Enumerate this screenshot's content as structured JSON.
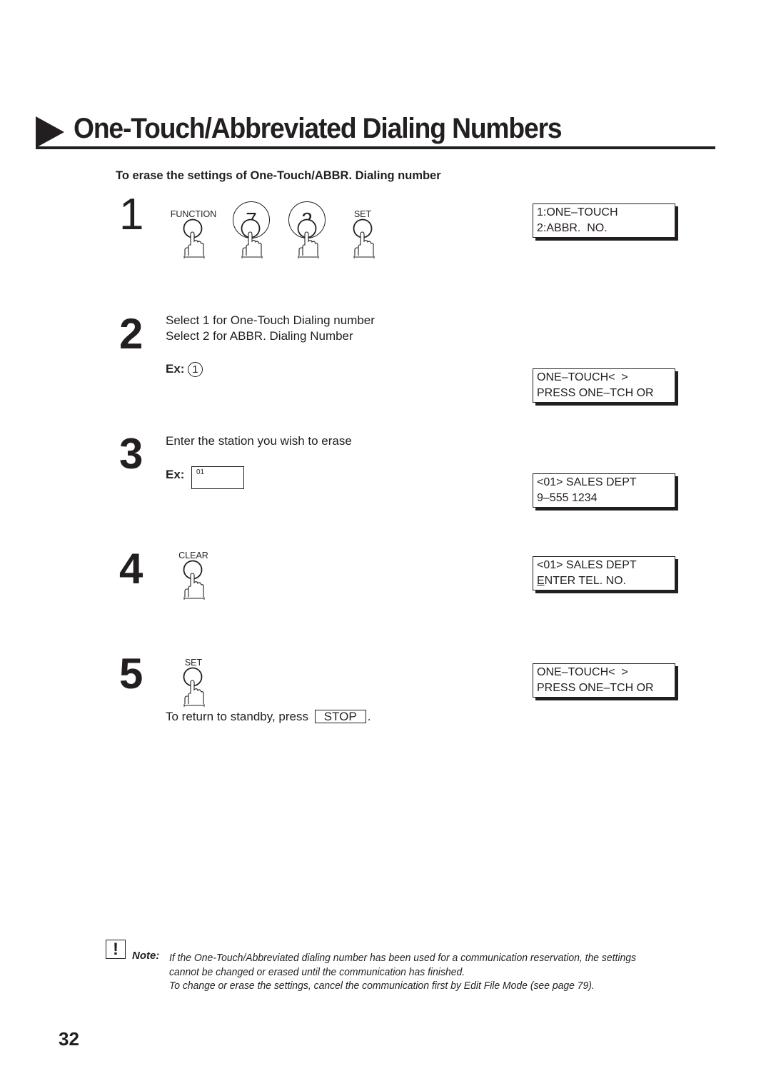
{
  "header": {
    "title": "One-Touch/Abbreviated Dialing Numbers",
    "subtitle": "To erase the settings of One-Touch/ABBR. Dialing number"
  },
  "steps": [
    {
      "number": "1",
      "keys": [
        {
          "label": "FUNCTION",
          "type": "small",
          "icon": "hand-press-icon"
        },
        {
          "label": "7",
          "type": "big",
          "icon": "hand-press-icon"
        },
        {
          "label": "2",
          "type": "big",
          "icon": "hand-press-icon"
        },
        {
          "label": "SET",
          "type": "small",
          "icon": "hand-press-icon"
        }
      ],
      "display": {
        "line1": "1:ONE–TOUCH",
        "line2": "2:ABBR.  NO."
      }
    },
    {
      "number": "2",
      "text_lines": [
        "Select 1 for One-Touch Dialing number",
        "Select 2 for ABBR. Dialing Number"
      ],
      "example_label": "Ex:",
      "example_value": "1",
      "display": {
        "line1": "ONE–TOUCH<  >",
        "line2": "PRESS ONE–TCH OR"
      }
    },
    {
      "number": "3",
      "text": "Enter the station you wish to erase",
      "example_label": "Ex:",
      "example_value": "01",
      "display": {
        "line1": "<01> SALES DEPT",
        "line2": "9–555 1234"
      }
    },
    {
      "number": "4",
      "keys": [
        {
          "label": "CLEAR",
          "type": "small",
          "icon": "hand-press-icon"
        }
      ],
      "display": {
        "line1": "<01> SALES DEPT",
        "line2_cursor": "E",
        "line2_rest": "NTER TEL. NO."
      }
    },
    {
      "number": "5",
      "keys": [
        {
          "label": "SET",
          "type": "small",
          "icon": "hand-press-icon"
        }
      ],
      "standby_text": "To return to standby, press",
      "stop_key": "STOP",
      "standby_end": ".",
      "display": {
        "line1": "ONE–TOUCH<  >",
        "line2": "PRESS ONE–TCH OR"
      }
    }
  ],
  "note": {
    "icon": "exclamation-icon",
    "label": "Note:",
    "lines": [
      "If the One-Touch/Abbreviated dialing number has been used for a communication reservation, the settings",
      "cannot be changed or erased until the communication has finished.",
      "To change or erase the settings, cancel the communication first by Edit File Mode (see page 79)."
    ]
  },
  "page_number": "32"
}
